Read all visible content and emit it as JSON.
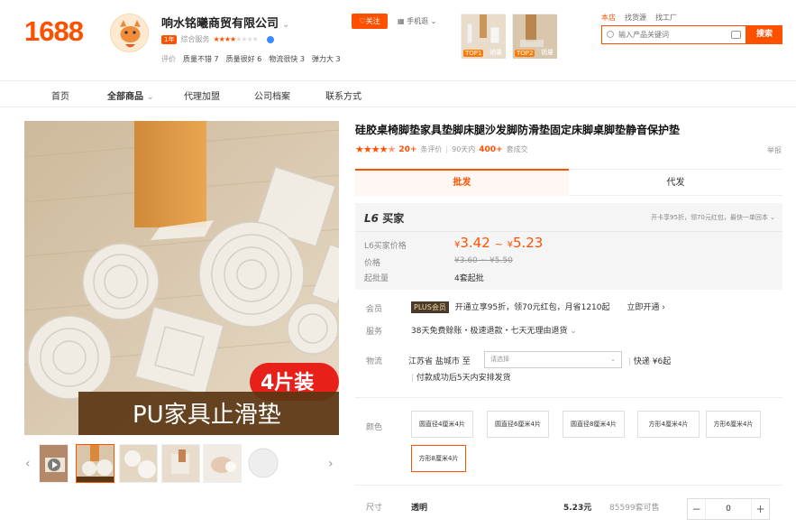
{
  "header": {
    "logo": "1688",
    "shop_name": "响水铭曦商贸有限公司",
    "year_badge": "1年",
    "score_label": "综合服务",
    "eval_label": "评价",
    "eval_items": [
      "质量不错 7",
      "质量很好 6",
      "物流很快 3",
      "弹力大 3"
    ],
    "follow_label": "关注",
    "mobile_label": "手机逛",
    "thumb1_tag": "TOP1",
    "thumb1_tag2": "销量",
    "thumb2_tag": "TOP2",
    "thumb2_tag2": "销量",
    "search_tabs": [
      "本店",
      "找货源",
      "找工厂"
    ],
    "search_placeholder": "输入产品关键词",
    "search_button": "搜索"
  },
  "nav": {
    "items": [
      "首页",
      "全部商品",
      "代理加盟",
      "公司档案",
      "联系方式"
    ]
  },
  "product": {
    "title": "硅胶桌椅脚垫家具垫脚床腿沙发脚防滑垫固定床脚桌脚垫静音保护垫",
    "rating_count": "20+",
    "rating_suffix": "条评价",
    "sales_prefix": "90天内",
    "sales_count": "400+",
    "sales_suffix": "套成交",
    "report": "举报",
    "image_tag": "4片装",
    "image_caption": "PU家具止滑垫",
    "rating_value": 4.5
  },
  "tabs": {
    "wholesale": "批发",
    "dropship": "代发"
  },
  "price": {
    "l6_label": "L6",
    "l6_sub": "买家",
    "l6_note": "开卡享95折，领70元红包，最快一单回本",
    "buyer_price_label": "L6买家价格",
    "buyer_price_low": "3.42",
    "buyer_price_high": "5.23",
    "currency": "¥",
    "price_label": "价格",
    "orig_price": "¥3.60 ~ ¥5.50",
    "moq_label": "起批量",
    "moq": "4套起批"
  },
  "member": {
    "label": "会员",
    "tag": "PLUS会员",
    "text": "开通立享95折，领70元红包，月省1210起",
    "open": "立即开通"
  },
  "service": {
    "label": "服务",
    "text": "38天免费赊账・极速退款・七天无理由退货"
  },
  "logistics": {
    "label": "物流",
    "from": "江苏省 盐城市  至",
    "select_placeholder": "请选择",
    "express": "快递  ¥6起",
    "note": "付款成功后5天内安排发货"
  },
  "color": {
    "label": "颜色",
    "options": [
      "圆直径4厘米4片",
      "圆直径6厘米4片",
      "圆直径8厘米4片",
      "方形4厘米4片",
      "方形6厘米4片",
      "方形8厘米4片"
    ],
    "selected_index": 5
  },
  "size": {
    "label": "尺寸",
    "value": "透明",
    "price": "5.23元",
    "stock": "85599套可售",
    "qty": "0",
    "minus": "−",
    "plus": "+"
  },
  "colors": {
    "accent": "#ff5000"
  }
}
